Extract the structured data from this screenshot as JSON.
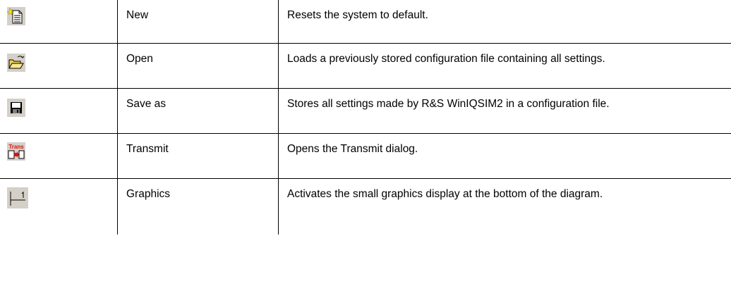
{
  "table": {
    "rows": [
      {
        "icon": "new-document-icon",
        "name": "New",
        "description": "Resets the system to default."
      },
      {
        "icon": "open-folder-icon",
        "name": "Open",
        "description": "Loads a previously stored configuration file containing all settings."
      },
      {
        "icon": "save-disk-icon",
        "name": "Save as",
        "description": "Stores all settings made by R&S WinIQSIM2 in a configuration file."
      },
      {
        "icon": "transmit-icon",
        "name": "Transmit",
        "description": "Opens the Transmit dialog."
      },
      {
        "icon": "graphics-marker-icon",
        "name": "Graphics",
        "description": "Activates the small graphics display at the bottom of the diagram."
      }
    ],
    "icon_text": {
      "transmit": "Trans"
    }
  },
  "colors": {
    "border": "#000000",
    "icon_background": "#d4d0c8",
    "transmit_red": "#e01010",
    "folder_yellow": "#f0d050"
  }
}
